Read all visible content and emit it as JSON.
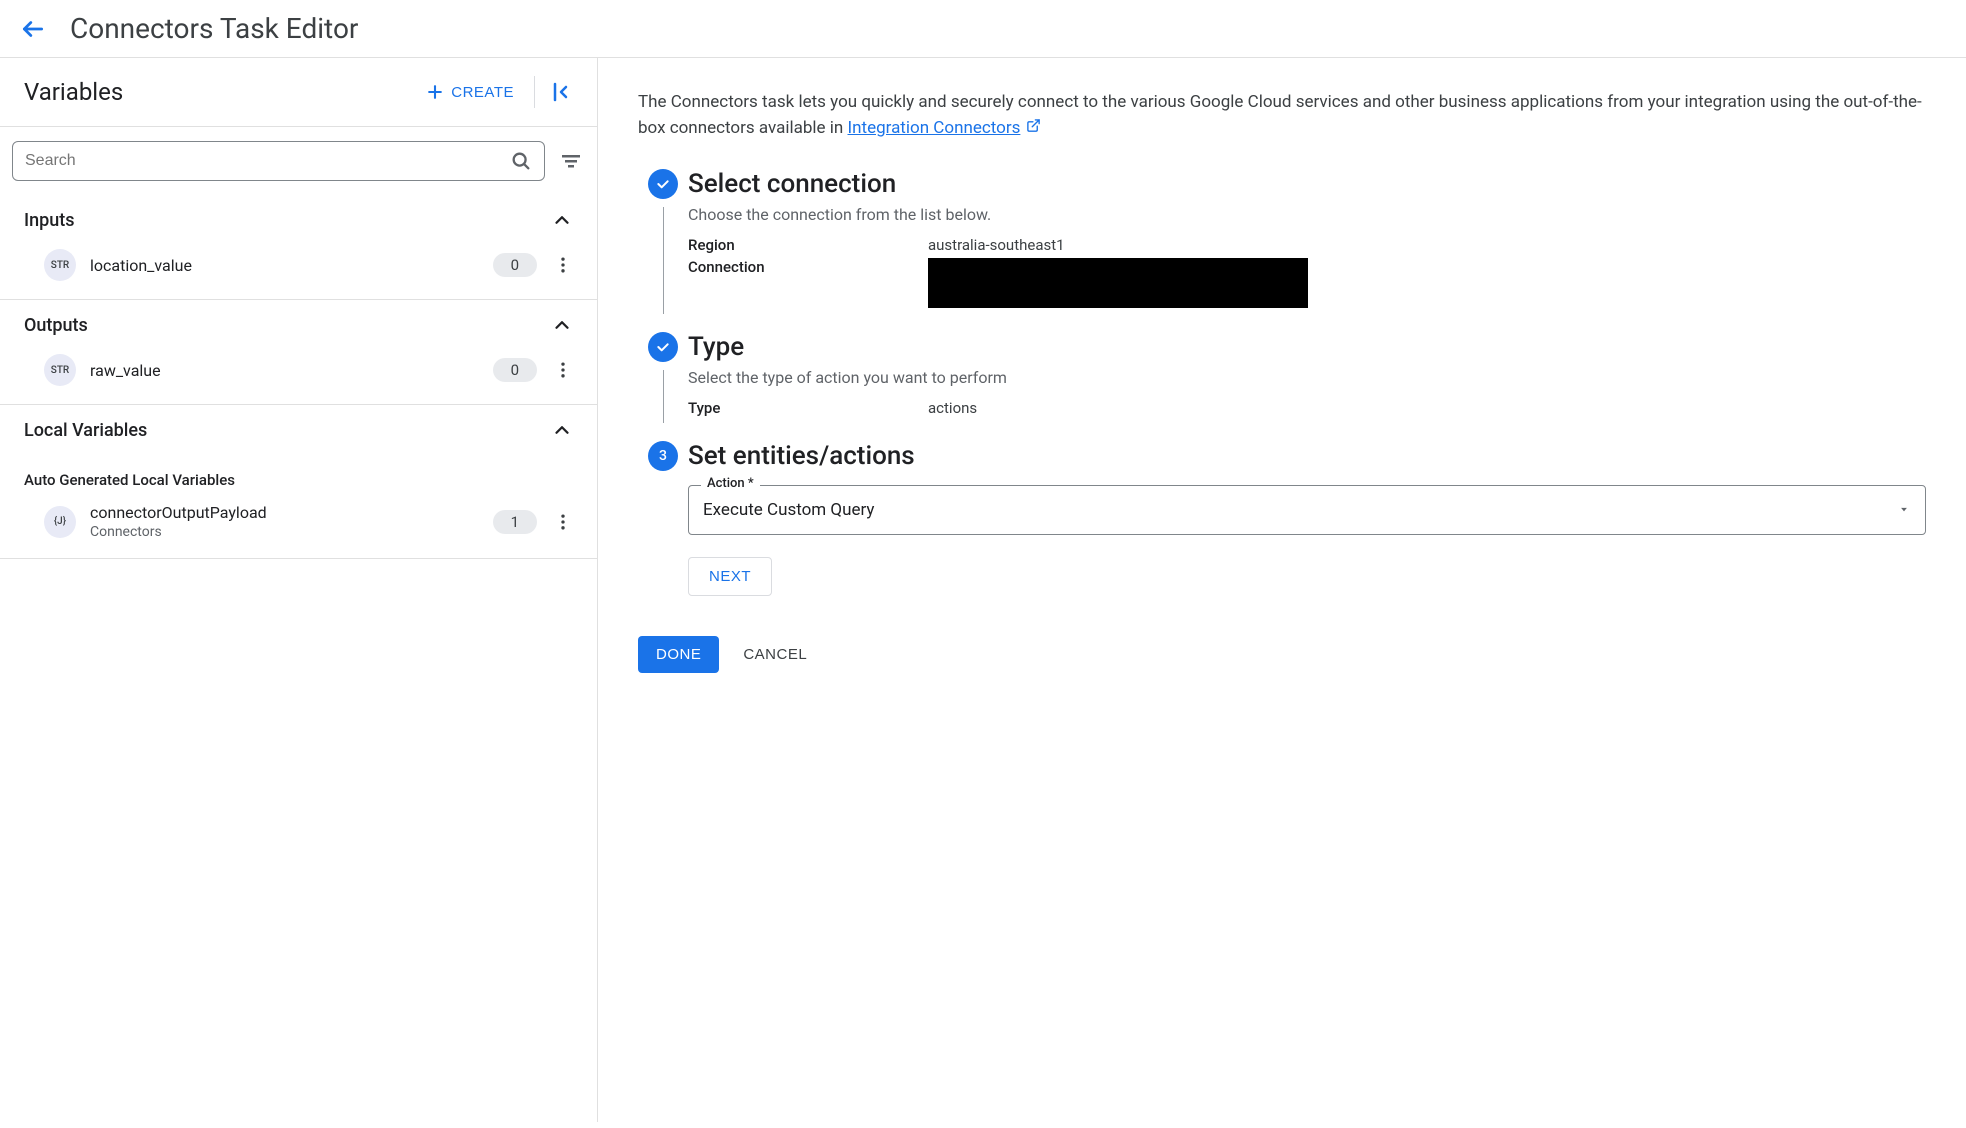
{
  "header": {
    "title": "Connectors Task Editor"
  },
  "left": {
    "title": "Variables",
    "create_label": "CREATE",
    "search_placeholder": "Search",
    "sections": {
      "inputs": {
        "title": "Inputs",
        "items": [
          {
            "type_badge": "STR",
            "name": "location_value",
            "count": "0"
          }
        ]
      },
      "outputs": {
        "title": "Outputs",
        "items": [
          {
            "type_badge": "STR",
            "name": "raw_value",
            "count": "0"
          }
        ]
      },
      "local": {
        "title": "Local Variables",
        "subheading": "Auto Generated Local Variables",
        "items": [
          {
            "type_badge": "{J}",
            "name": "connectorOutputPayload",
            "sub": "Connectors",
            "count": "1"
          }
        ]
      }
    }
  },
  "right": {
    "intro_prefix": "The Connectors task lets you quickly and securely connect to the various Google Cloud services and other business applications from your integration using the out-of-the-box connectors available in ",
    "intro_link": "Integration Connectors",
    "steps": {
      "s1": {
        "title": "Select connection",
        "subtitle": "Choose the connection from the list below.",
        "region_label": "Region",
        "region_value": "australia-southeast1",
        "connection_label": "Connection"
      },
      "s2": {
        "title": "Type",
        "subtitle": "Select the type of action you want to perform",
        "type_label": "Type",
        "type_value": "actions"
      },
      "s3": {
        "number": "3",
        "title": "Set entities/actions",
        "action_label": "Action *",
        "action_value": "Execute Custom Query",
        "next_label": "NEXT"
      }
    },
    "done_label": "DONE",
    "cancel_label": "CANCEL"
  }
}
